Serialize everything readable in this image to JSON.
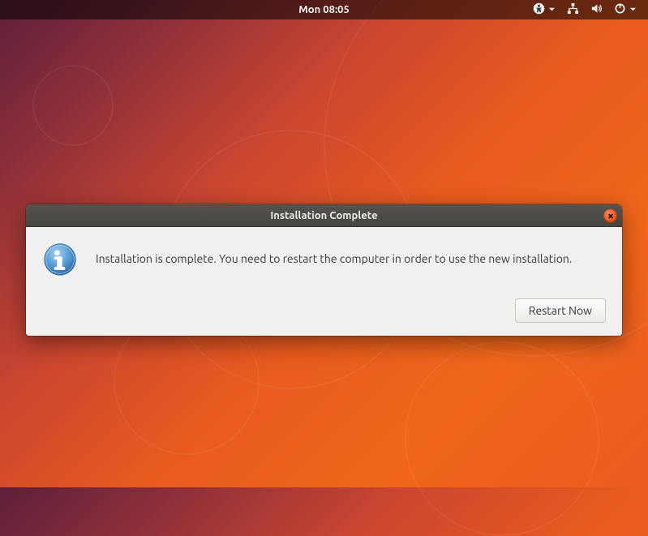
{
  "menubar": {
    "clock": "Mon 08:05"
  },
  "dialog": {
    "title": "Installation Complete",
    "message": "Installation is complete. You need to restart the computer in order to use the new installation.",
    "restart_label": "Restart Now"
  }
}
